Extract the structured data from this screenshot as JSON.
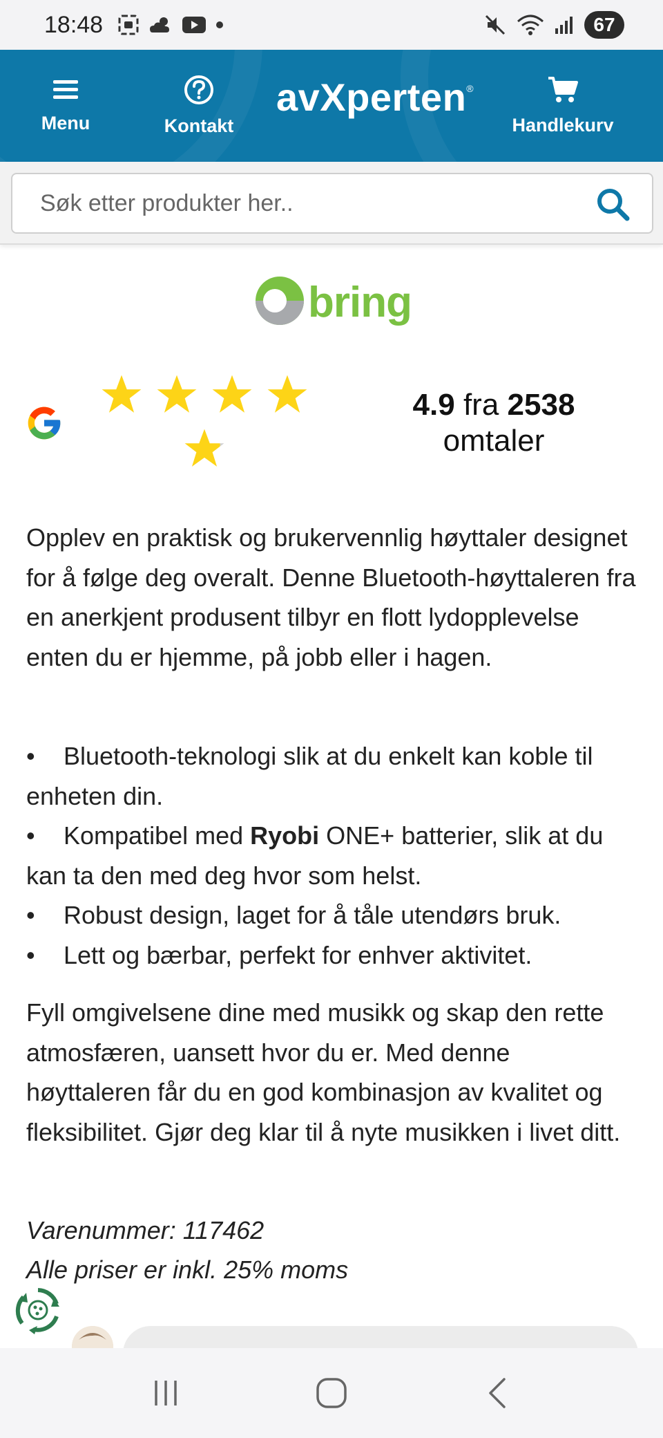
{
  "status_bar": {
    "time": "18:48",
    "battery": "67",
    "icons": [
      "screenshot-icon",
      "weather-icon",
      "youtube-icon",
      "dot-icon",
      "mute-icon",
      "wifi-icon",
      "signal-icon"
    ]
  },
  "header": {
    "menu_label": "Menu",
    "contact_label": "Kontakt",
    "logo_text": "avXperten",
    "logo_mark": "®",
    "cart_label": "Handlekurv",
    "background_color": "#0e78a8"
  },
  "search": {
    "placeholder": "Søk etter produkter her.."
  },
  "shipping": {
    "brand": "bring"
  },
  "rating": {
    "score": "4.9",
    "from_word": "fra",
    "count": "2538",
    "reviews_word": "omtaler",
    "stars_value": 4.9,
    "stars_max": 5,
    "source_icon": "google-icon"
  },
  "description": {
    "intro": "Opplev en praktisk og brukervennlig høyttaler designet for å følge deg overalt. Denne Bluetooth-høyttaleren fra en anerkjent produsent tilbyr en flott lydopplevelse enten du er hjemme, på jobb eller i hagen.",
    "bullets": [
      {
        "text": "Bluetooth-teknologi slik at du enkelt kan koble til enheten din."
      },
      {
        "pre": "Kompatibel med ",
        "bold": "Ryobi",
        "post": " ONE+ batterier, slik at du kan ta den med deg hvor som helst."
      },
      {
        "text": "Robust design, laget for å tåle utendørs bruk."
      },
      {
        "text": "Lett og bærbar, perfekt for enhver aktivitet."
      }
    ],
    "outro": "Fyll omgivelsene dine med musikk og skap den rette atmosfæren, uansett hvor du er. Med denne høyttaleren får du en god kombinasjon av kvalitet og fleksibilitet. Gjør deg klar til å nyte musikken i livet ditt.",
    "sku_line": "Varenummer: 117462",
    "vat_line": "Alle priser er inkl. 25% moms"
  },
  "colors": {
    "brand_blue": "#0e78a8",
    "bring_green": "#7bc143",
    "star_yellow": "#fdd417"
  }
}
